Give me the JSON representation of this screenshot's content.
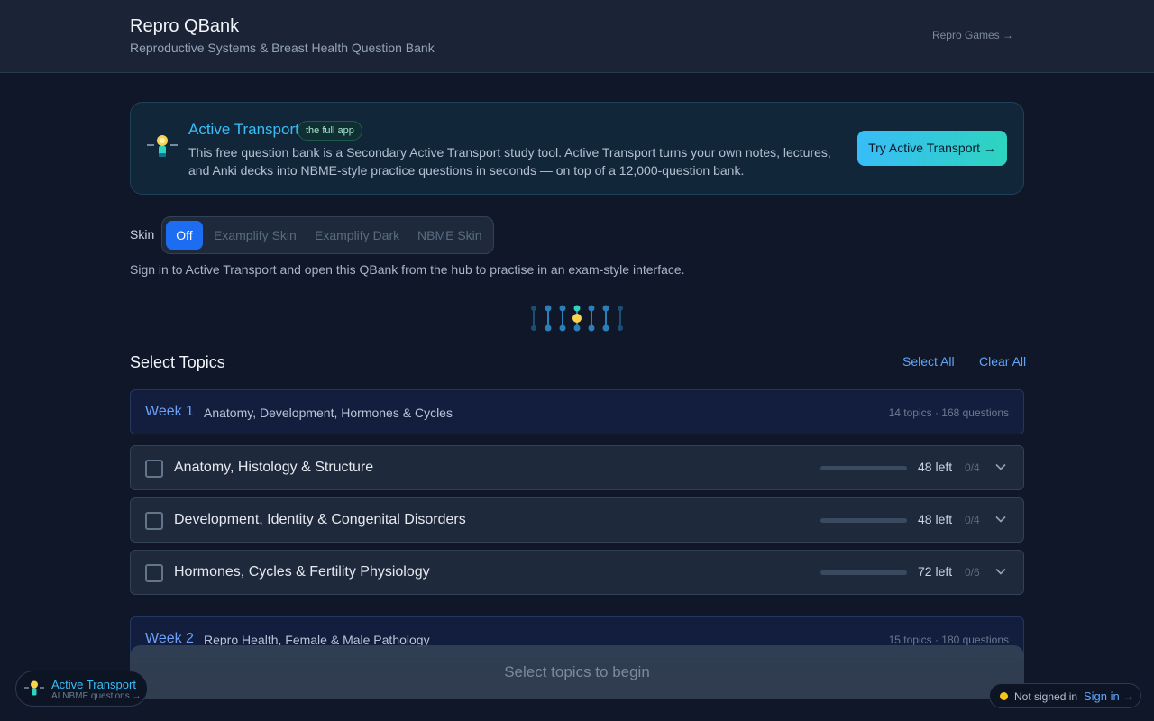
{
  "header": {
    "title": "Repro QBank",
    "subtitle": "Reproductive Systems & Breast Health Question Bank",
    "games_link": "Repro Games →"
  },
  "promo": {
    "icon": "lightbulb-icon",
    "title": "Active Transport",
    "tag": "the full app",
    "text": "This free question bank is a Secondary Active Transport study tool. Active Transport turns your own notes, lectures, and Anki decks into NBME-style practice questions in seconds — on top of a 12,000-question bank.",
    "button": "Try Active Transport →"
  },
  "skin": {
    "label": "Skin",
    "options": [
      "Off",
      "Examplify Skin",
      "Examplify Dark",
      "NBME Skin"
    ],
    "selected": "Off",
    "note": "Sign in to Active Transport and open this QBank from the hub to practise in an exam-style interface."
  },
  "topics_header": {
    "title": "Select Topics",
    "select_all": "Select All",
    "clear_all": "Clear All"
  },
  "weeks": [
    {
      "label": "Week 1",
      "desc": "Anatomy, Development, Hormones & Cycles",
      "meta": "14 topics · 168 questions",
      "topics": [
        {
          "name": "Anatomy, Histology & Structure",
          "left": "48 left",
          "ratio": "0/4",
          "progress": 0
        },
        {
          "name": "Development, Identity & Congenital Disorders",
          "left": "48 left",
          "ratio": "0/4",
          "progress": 0
        },
        {
          "name": "Hormones, Cycles & Fertility Physiology",
          "left": "72 left",
          "ratio": "0/6",
          "progress": 0
        }
      ]
    },
    {
      "label": "Week 2",
      "desc": "Repro Health, Female & Male Pathology",
      "meta": "15 topics · 180 questions"
    }
  ],
  "begin_button": "Select topics to begin",
  "float_badge": {
    "title": "Active Transport",
    "subtitle": "AI NBME questions →"
  },
  "status": {
    "text": "Not signed in",
    "signin": "Sign in →",
    "dot_color": "#f5c518"
  },
  "colors": {
    "accent": "#38bdf8",
    "primary_button": "#1d6df2",
    "link": "#60a5fa"
  }
}
